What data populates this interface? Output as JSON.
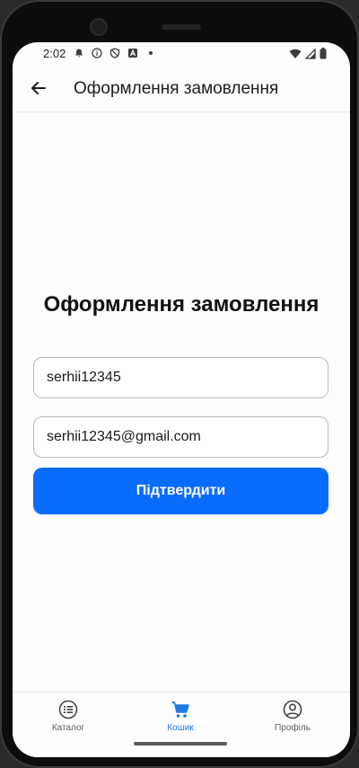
{
  "status_bar": {
    "time": "2:02",
    "left_icons": [
      "notification-bell-icon",
      "info-icon",
      "shield-icon",
      "a-box-icon",
      "dot-icon"
    ],
    "right_icons": [
      "wifi-icon",
      "signal-icon",
      "battery-icon"
    ]
  },
  "appbar": {
    "back_icon": "arrow-left-icon",
    "title": "Оформлення замовлення"
  },
  "main": {
    "heading": "Оформлення замовлення",
    "name_value": "serhii12345",
    "email_value": "serhii12345@gmail.com",
    "confirm_label": "Підтвердити"
  },
  "bottom_nav": {
    "items": [
      {
        "label": "Каталог",
        "icon": "list-icon",
        "active": false
      },
      {
        "label": "Кошик",
        "icon": "cart-icon",
        "active": true
      },
      {
        "label": "Профіль",
        "icon": "account-icon",
        "active": false
      }
    ]
  },
  "colors": {
    "accent": "#0a6cff",
    "active_nav": "#1f7ae0",
    "text": "#111111"
  }
}
